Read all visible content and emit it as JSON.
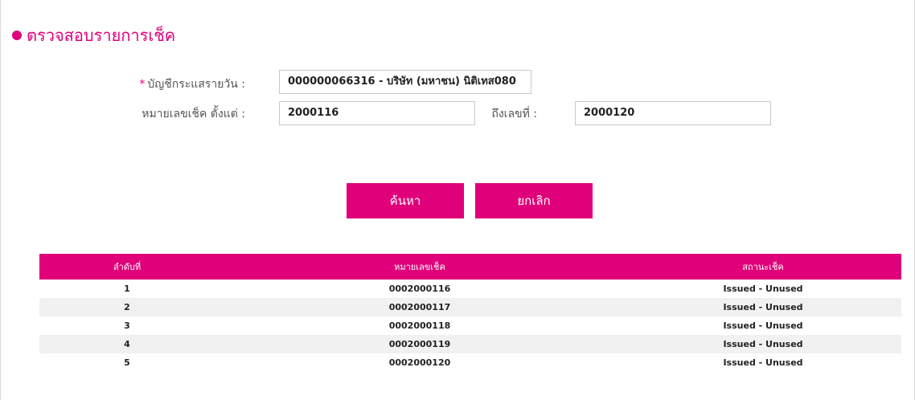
{
  "page": {
    "title": "ตรวจสอบรายการเช็ค"
  },
  "form": {
    "account_required_mark": "*",
    "account_label": "บัญชีกระแสรายวัน :",
    "account_value": "000000066316 - บริษัท (มหาชน) นิติเทส080",
    "cheque_from_label": "หมายเลขเช็ค ตั้งแต่ :",
    "cheque_from_value": "2000116",
    "cheque_to_label": "ถึงเลขที่ :",
    "cheque_to_value": "2000120"
  },
  "buttons": {
    "search": "ค้นหา",
    "cancel": "ยกเลิก"
  },
  "table": {
    "headers": [
      "ลำดับที่",
      "หมายเลขเช็ค",
      "สถานะเช็ค"
    ],
    "rows": [
      [
        "1",
        "0002000116",
        "Issued - Unused"
      ],
      [
        "2",
        "0002000117",
        "Issued - Unused"
      ],
      [
        "3",
        "0002000118",
        "Issued - Unused"
      ],
      [
        "4",
        "0002000119",
        "Issued - Unused"
      ],
      [
        "5",
        "0002000120",
        "Issued - Unused"
      ]
    ]
  },
  "colors": {
    "accent": "#e0007a",
    "row_alt": "#f1f1f1"
  }
}
